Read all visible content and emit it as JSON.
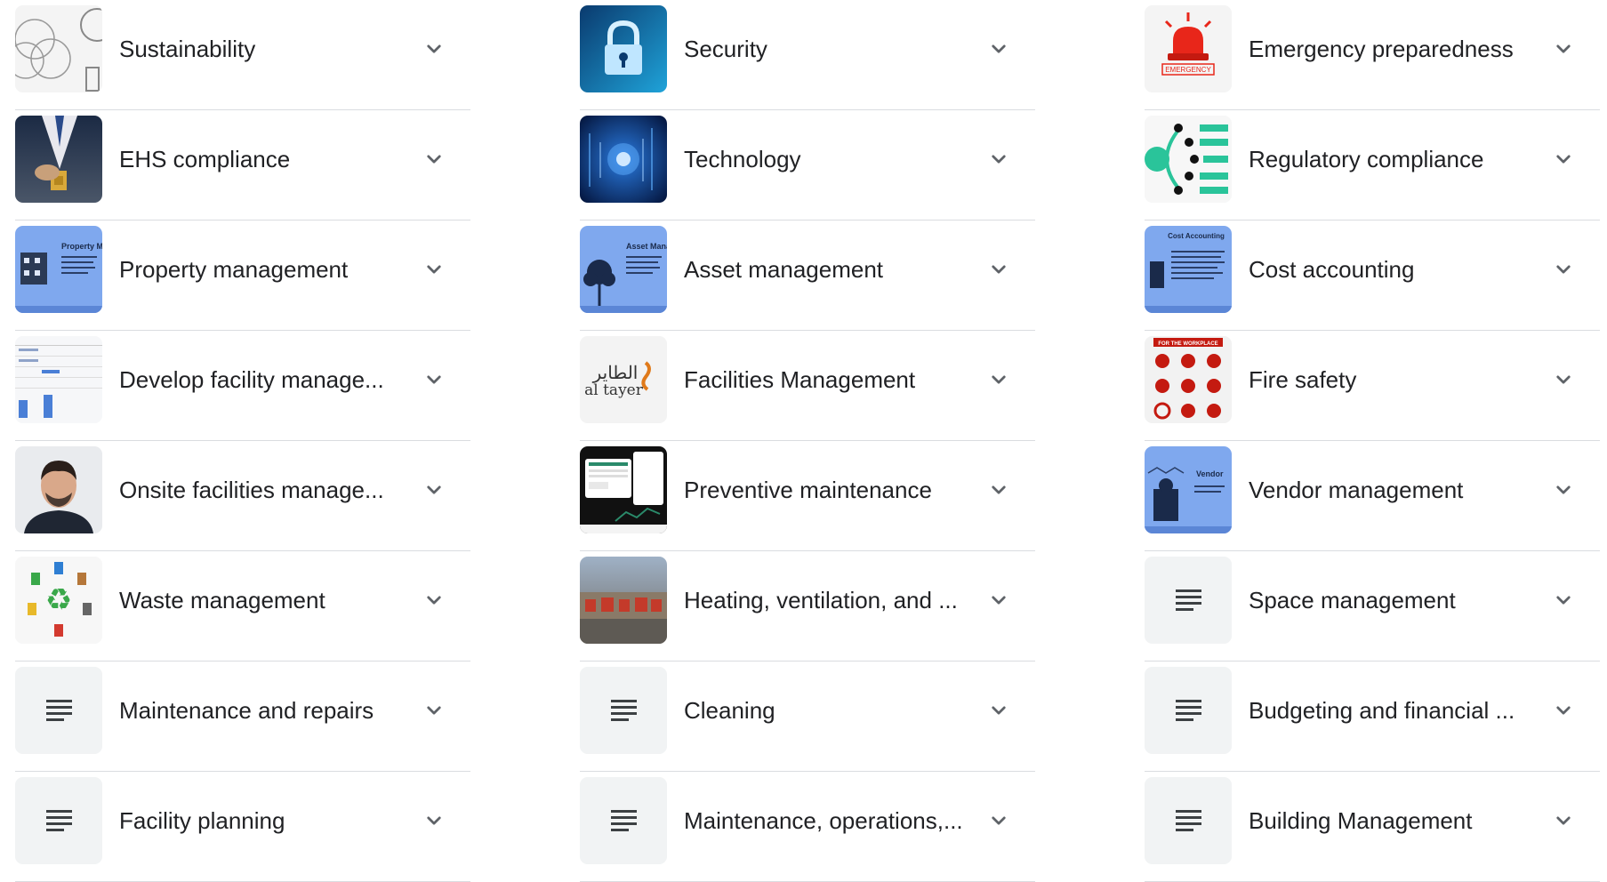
{
  "columns": [
    {
      "items": [
        {
          "label": "Sustainability",
          "icon": "sustainability-diagram-thumbnail"
        },
        {
          "label": "EHS compliance",
          "icon": "ehs-compliance-photo-thumbnail"
        },
        {
          "label": "Property management",
          "icon": "property-management-slide-thumbnail",
          "thumb_text": "Property Manageme"
        },
        {
          "label": "Develop facility manage...",
          "icon": "spreadsheet-thumbnail"
        },
        {
          "label": "Onsite facilities manage...",
          "icon": "person-portrait-thumbnail"
        },
        {
          "label": "Waste management",
          "icon": "recycling-bins-thumbnail"
        },
        {
          "label": "Maintenance and repairs",
          "icon": "document-lines-icon"
        },
        {
          "label": "Facility planning",
          "icon": "document-lines-icon"
        }
      ]
    },
    {
      "items": [
        {
          "label": "Security",
          "icon": "padlock-thumbnail"
        },
        {
          "label": "Technology",
          "icon": "digital-technology-thumbnail"
        },
        {
          "label": "Asset management",
          "icon": "asset-management-slide-thumbnail",
          "thumb_text": "Asset Manageme"
        },
        {
          "label": "Facilities Management",
          "icon": "al-tayer-logo-thumbnail",
          "thumb_text": "al tayer"
        },
        {
          "label": "Preventive maintenance",
          "icon": "dashboard-screenshot-thumbnail"
        },
        {
          "label": "Heating, ventilation, and ...",
          "icon": "hvac-building-photo-thumbnail"
        },
        {
          "label": "Cleaning",
          "icon": "document-lines-icon"
        },
        {
          "label": "Maintenance, operations,...",
          "icon": "document-lines-icon"
        }
      ]
    },
    {
      "items": [
        {
          "label": "Emergency preparedness",
          "icon": "emergency-siren-thumbnail",
          "thumb_text": "EMERGENCY"
        },
        {
          "label": "Regulatory compliance",
          "icon": "compliance-steps-diagram-thumbnail"
        },
        {
          "label": "Cost accounting",
          "icon": "cost-accounting-slide-thumbnail",
          "thumb_text": "Cost Accounting"
        },
        {
          "label": "Fire safety",
          "icon": "fire-safety-signs-thumbnail",
          "thumb_text": "FOR THE WORKPLACE"
        },
        {
          "label": "Vendor management",
          "icon": "vendor-management-slide-thumbnail",
          "thumb_text": "Vendor"
        },
        {
          "label": "Space management",
          "icon": "document-lines-icon"
        },
        {
          "label": "Budgeting and financial ...",
          "icon": "document-lines-icon"
        },
        {
          "label": "Building Management",
          "icon": "document-lines-icon"
        }
      ]
    }
  ],
  "colors": {
    "text": "#202124",
    "divider": "#dadce0",
    "chevron": "#5f6368",
    "placeholder_bg": "#f1f3f4",
    "slide_blue": "#7fa8ee"
  }
}
